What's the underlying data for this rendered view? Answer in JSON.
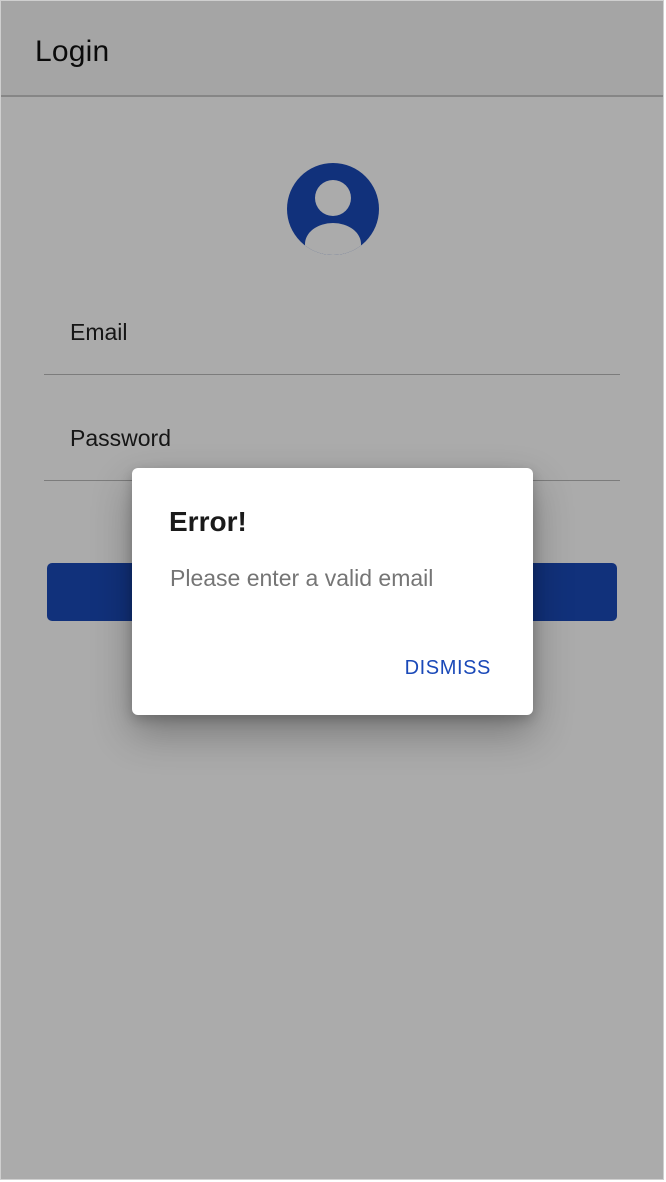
{
  "toolbar": {
    "title": "Login"
  },
  "avatar": {
    "icon": "person-circle-icon",
    "color": "#1a49b8"
  },
  "form": {
    "email_label": "Email",
    "password_label": "Password",
    "login_button_label": ""
  },
  "dialog": {
    "title": "Error!",
    "message": "Please enter a valid email",
    "action_label": "DISMISS"
  },
  "colors": {
    "accent": "#1a49b8",
    "scrim": "rgba(0,0,0,0.33)"
  }
}
